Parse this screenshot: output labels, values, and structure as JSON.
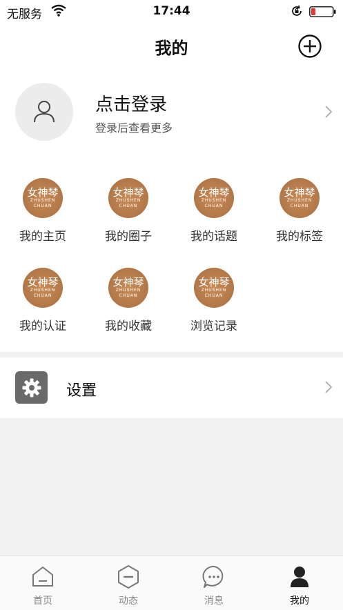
{
  "status_bar": {
    "carrier": "无服务",
    "time": "17:44"
  },
  "nav": {
    "title": "我的"
  },
  "profile": {
    "login_label": "点击登录",
    "hint": "登录后查看更多"
  },
  "grid": {
    "logo_main": "女神琴",
    "logo_sub": "ZHUSHEN CHUAN",
    "items": [
      {
        "label": "我的主页"
      },
      {
        "label": "我的圈子"
      },
      {
        "label": "我的话题"
      },
      {
        "label": "我的标签"
      },
      {
        "label": "我的认证"
      },
      {
        "label": "我的收藏"
      },
      {
        "label": "浏览记录"
      }
    ]
  },
  "settings": {
    "label": "设置"
  },
  "tabs": [
    {
      "label": "首页",
      "icon": "home-icon"
    },
    {
      "label": "动态",
      "icon": "dynamic-icon"
    },
    {
      "label": "消息",
      "icon": "message-icon"
    },
    {
      "label": "我的",
      "icon": "profile-icon",
      "active": true
    }
  ],
  "colors": {
    "battery_low": "#e53935",
    "settings_icon_bg": "#6a6a6a",
    "logo": "#b47a4a"
  }
}
